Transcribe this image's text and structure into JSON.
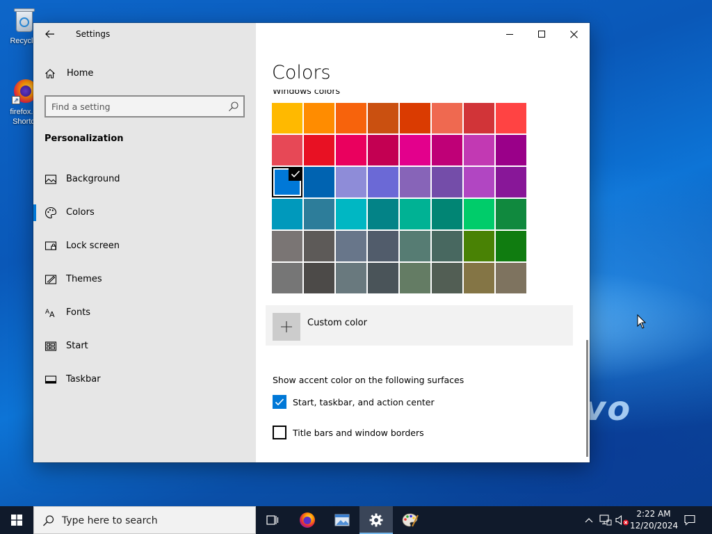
{
  "desktop": {
    "icons": [
      {
        "label": "Recycle",
        "icon": "recycle-bin-icon"
      },
      {
        "label": "firefox.e",
        "label2": "Shortc",
        "icon": "firefox-icon"
      }
    ],
    "brand_text": "vo"
  },
  "window": {
    "title": "Settings",
    "sidebar": {
      "home_label": "Home",
      "search_placeholder": "Find a setting",
      "section_title": "Personalization",
      "items": [
        {
          "label": "Background",
          "icon": "picture-icon"
        },
        {
          "label": "Colors",
          "icon": "palette-icon",
          "active": true
        },
        {
          "label": "Lock screen",
          "icon": "lock-screen-icon"
        },
        {
          "label": "Themes",
          "icon": "themes-icon"
        },
        {
          "label": "Fonts",
          "icon": "fonts-icon"
        },
        {
          "label": "Start",
          "icon": "start-icon"
        },
        {
          "label": "Taskbar",
          "icon": "taskbar-icon"
        }
      ]
    },
    "content": {
      "page_title": "Colors",
      "windows_colors_heading": "Windows colors",
      "swatches": [
        [
          "#FFB900",
          "#FF8C00",
          "#F7630C",
          "#CA5010",
          "#DA3B01",
          "#EF6950",
          "#D13438",
          "#FF4343"
        ],
        [
          "#E74856",
          "#E81123",
          "#EA005E",
          "#C30052",
          "#E3008C",
          "#BF0077",
          "#C239B3",
          "#9A0089"
        ],
        [
          "#0078D7",
          "#0063B1",
          "#8E8CD8",
          "#6B69D6",
          "#8764B8",
          "#744DA9",
          "#B146C2",
          "#881798"
        ],
        [
          "#0099BC",
          "#2D7D9A",
          "#00B7C3",
          "#038387",
          "#00B294",
          "#018574",
          "#00CC6A",
          "#10893E"
        ],
        [
          "#7A7574",
          "#5D5A58",
          "#68768A",
          "#515C6B",
          "#567C73",
          "#486860",
          "#498205",
          "#107C10"
        ],
        [
          "#767676",
          "#4C4A48",
          "#69797E",
          "#4A5459",
          "#647C64",
          "#525E54",
          "#847545",
          "#7E735F"
        ]
      ],
      "selected_swatch": {
        "row": 2,
        "col": 0
      },
      "custom_color_label": "Custom color",
      "surfaces_heading": "Show accent color on the following surfaces",
      "checkboxes": [
        {
          "label": "Start, taskbar, and action center",
          "checked": true
        },
        {
          "label": "Title bars and window borders",
          "checked": false
        }
      ]
    }
  },
  "taskbar": {
    "search_placeholder": "Type here to search",
    "apps": [
      {
        "name": "task-view",
        "icon": "task-view-icon"
      },
      {
        "name": "firefox",
        "icon": "firefox-icon"
      },
      {
        "name": "screen-snip",
        "icon": "window-snip-icon"
      },
      {
        "name": "settings",
        "icon": "gear-icon",
        "active": true
      },
      {
        "name": "paint",
        "icon": "paint-palette-icon"
      }
    ],
    "clock_time": "2:22 AM",
    "clock_date": "12/20/2024"
  },
  "colors": {
    "accent": "#0078D7",
    "sidebar_bg": "#E6E6E6",
    "taskbar_bg": "#101A2B"
  }
}
